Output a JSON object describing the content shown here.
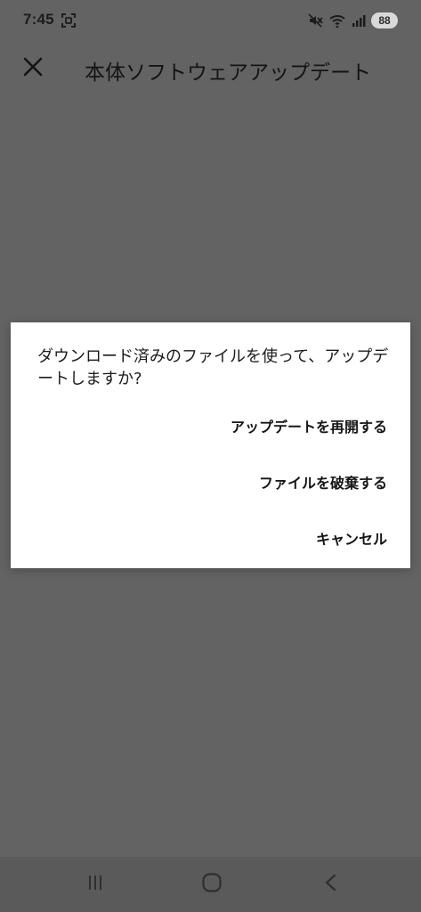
{
  "status_bar": {
    "time": "7:45",
    "battery": "88",
    "icons": [
      "screenshot-icon",
      "mute-icon",
      "wifi-icon",
      "signal-icon",
      "battery-badge"
    ]
  },
  "app_bar": {
    "title": "本体ソフトウェアアップデート",
    "close_icon": "close-icon"
  },
  "dialog": {
    "message": "ダウンロード済みのファイルを使って、アップデートしますか?",
    "actions": [
      {
        "label": "アップデートを再開する"
      },
      {
        "label": "ファイルを破棄する"
      },
      {
        "label": "キャンセル"
      }
    ]
  },
  "nav_bar": {
    "icons": [
      "recents-icon",
      "home-icon",
      "back-icon"
    ]
  },
  "colors": {
    "background_dim": "#636363",
    "dialog_bg": "#ffffff",
    "text": "#151515",
    "nav_bg": "#5a5a5a"
  }
}
